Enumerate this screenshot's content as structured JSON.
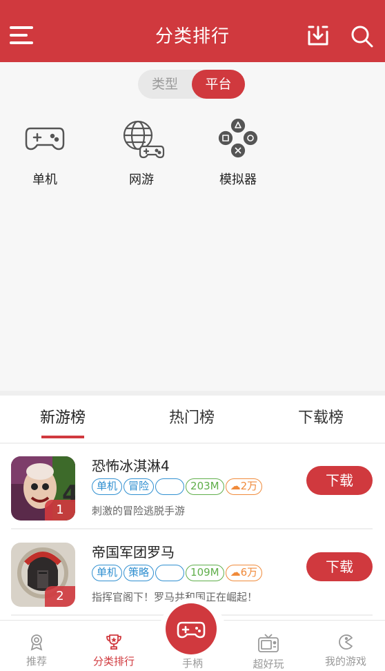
{
  "header": {
    "title": "分类排行",
    "menu_icon": "menu-icon",
    "download_icon": "download-icon",
    "search_icon": "search-icon"
  },
  "toggle": {
    "type_label": "类型",
    "platform_label": "平台",
    "selected": "平台"
  },
  "categories": [
    {
      "label": "单机",
      "icon": "gamepad-icon"
    },
    {
      "label": "网游",
      "icon": "globe-gamepad-icon"
    },
    {
      "label": "模拟器",
      "icon": "console-buttons-icon"
    }
  ],
  "tabs": [
    {
      "label": "新游榜",
      "active": true
    },
    {
      "label": "热门榜",
      "active": false
    },
    {
      "label": "下载榜",
      "active": false
    }
  ],
  "games": [
    {
      "rank": "1",
      "name": "恐怖冰淇淋4",
      "tags": [
        "单机",
        "冒险",
        ""
      ],
      "size": "203M",
      "downloads": "2万",
      "desc": "刺激的冒险逃脱手游",
      "button": "下载"
    },
    {
      "rank": "2",
      "name": "帝国军团罗马",
      "tags": [
        "单机",
        "策略",
        ""
      ],
      "size": "109M",
      "downloads": "6万",
      "desc": "指挥官阁下！罗马共和国正在崛起！",
      "button": "下载"
    }
  ],
  "bottom_nav": [
    {
      "label": "推荐",
      "icon": "recommend-icon",
      "active": false
    },
    {
      "label": "分类排行",
      "icon": "trophy-icon",
      "active": true
    },
    {
      "label": "手柄",
      "icon": "gamepad-icon",
      "active": false
    },
    {
      "label": "超好玩",
      "icon": "tv-icon",
      "active": false
    },
    {
      "label": "我的游戏",
      "icon": "pacman-icon",
      "active": false
    }
  ],
  "colors": {
    "brand": "#d0393e",
    "tag_blue": "#2f8fd0",
    "tag_green": "#5fae4a",
    "tag_orange": "#f08a3a"
  }
}
